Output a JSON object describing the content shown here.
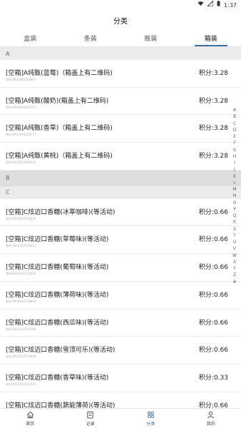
{
  "status": {
    "time": "1:37",
    "icons": [
      "wifi-icon",
      "signal-icon",
      "battery-icon"
    ]
  },
  "header": {
    "title": "分类"
  },
  "tabs": [
    {
      "label": "盒装",
      "active": false
    },
    {
      "label": "条装",
      "active": false
    },
    {
      "label": "瓶装",
      "active": false
    },
    {
      "label": "箱装",
      "active": true
    }
  ],
  "sections": [
    {
      "letter": "A",
      "items": [
        {
          "name": "[空箱]A纯甄(蓝莓)（箱盖上有二维码)",
          "code": "条码:6923644266837",
          "score": "积分:3.28"
        },
        {
          "name": "[空箱]A纯甄(酸奶)(箱盖上有二维码)",
          "code": "条码:6923644268701",
          "score": "积分:3.28"
        },
        {
          "name": "[空箱]A纯甄(香草)（箱盖上有二维码)",
          "code": "条码:6923644268757",
          "score": "积分:3.28"
        },
        {
          "name": "[空箱]A纯甄(黄桃)（箱盖上有二维码)",
          "code": "条码:6923644268054",
          "score": "积分:3.28"
        }
      ]
    },
    {
      "letter": "B",
      "items": []
    },
    {
      "letter": "C",
      "items": [
        {
          "name": "[空箱]C炫迈口香糖(冰萃咖啡)(等活动)",
          "code": "条码:6954432710659",
          "score": "积分:0.66"
        },
        {
          "name": "[空箱]C炫迈口香糖(草莓味)(等活动)",
          "code": "条码:6954432710011",
          "score": "积分:0.66"
        },
        {
          "name": "[空箱]C炫迈口香糖(葡萄味)(等活动)",
          "code": "条码:6954432710028",
          "score": "积分:0.66"
        },
        {
          "name": "[空箱]C炫迈口香糖(薄荷味)(等活动)",
          "code": "条码:6954432710004",
          "score": "积分:0.66"
        },
        {
          "name": "[空箱]C炫迈口香糖(西瓜味)(等活动)",
          "code": "条码:6954432710790",
          "score": "积分:0.66"
        },
        {
          "name": "[空箱]C炫迈口香糖(雪顶可乐)(等活动)",
          "code": "条码:6954432712060",
          "score": "积分:0.66"
        },
        {
          "name": "[空箱]C炫迈口香糖(香草味)(等活动)",
          "code": "条码:6954432710035",
          "score": "积分:0.33"
        },
        {
          "name": "[空箱]C炫迈口香糖(蔬能薄荷)(等活动)",
          "code": "",
          "score": "积分:0.66"
        }
      ]
    }
  ],
  "alphabet": [
    "A",
    "B",
    "C",
    "D",
    "E",
    "F",
    "G",
    "H",
    "I",
    "J",
    "K",
    "L",
    "M",
    "N",
    "O",
    "P",
    "Q",
    "R",
    "S",
    "T",
    "U",
    "V",
    "W",
    "X",
    "Y",
    "Z",
    "#"
  ],
  "bottom_nav": [
    {
      "label": "首页",
      "icon": "home-icon",
      "active": false
    },
    {
      "label": "记录",
      "icon": "record-icon",
      "active": false
    },
    {
      "label": "分类",
      "icon": "category-icon",
      "active": true
    },
    {
      "label": "我的",
      "icon": "profile-icon",
      "active": false
    }
  ],
  "colors": {
    "accent": "#3a6ea5"
  }
}
